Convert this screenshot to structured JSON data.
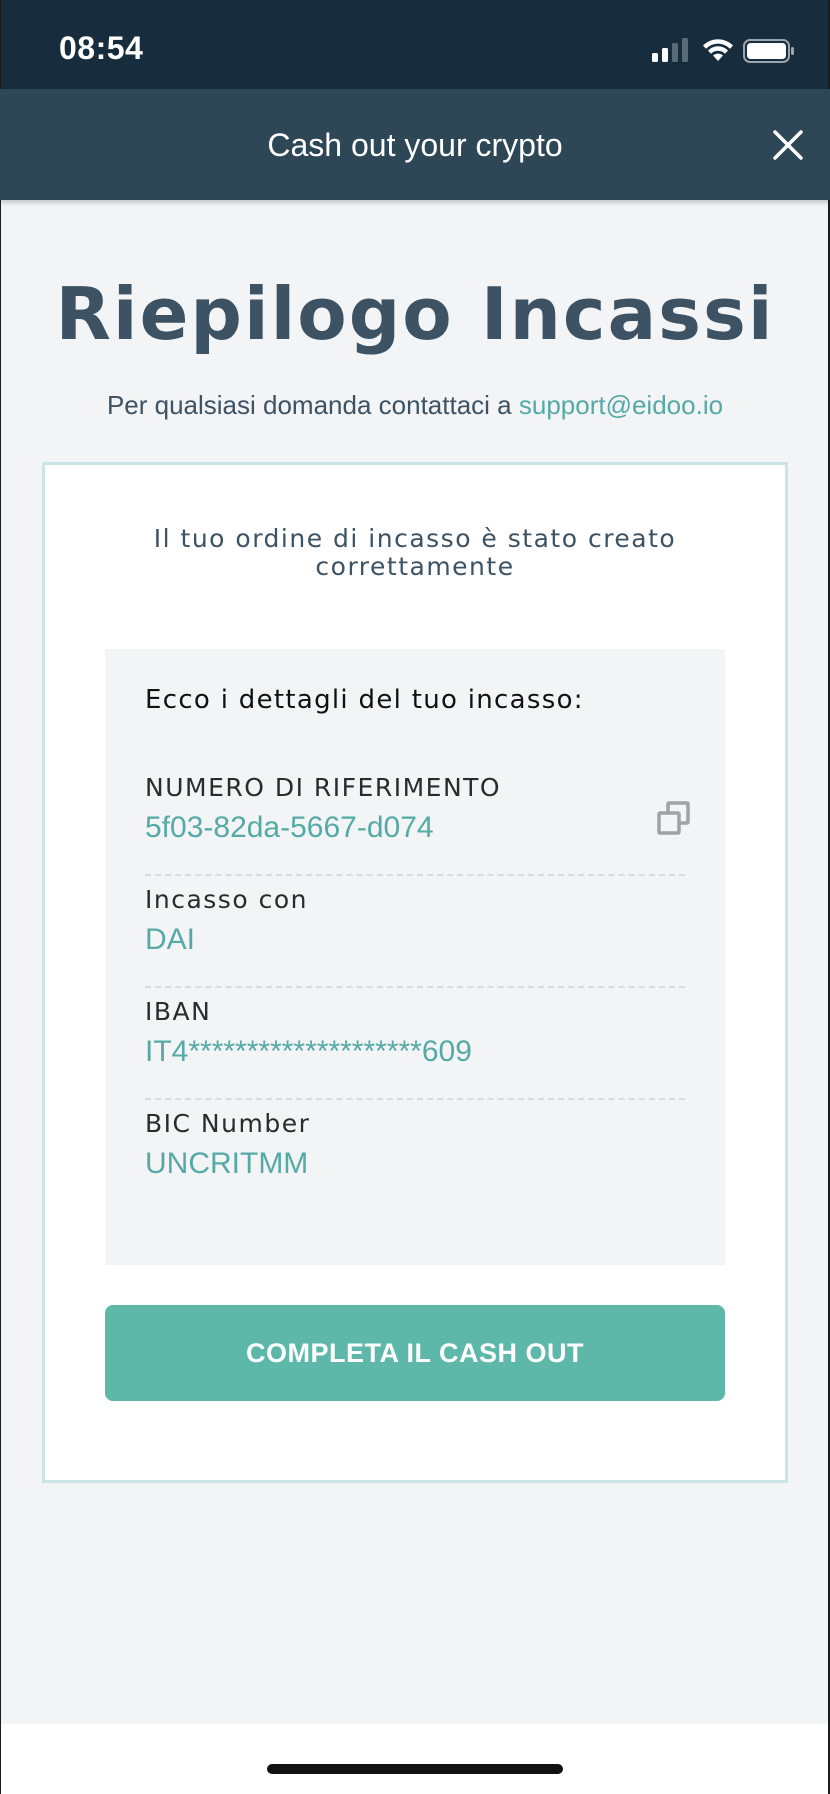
{
  "status_bar": {
    "time": "08:54"
  },
  "nav": {
    "title": "Cash out your crypto",
    "close_icon": "close-icon"
  },
  "page": {
    "title": "Riepilogo Incassi",
    "contact_text": "Per qualsiasi domanda contattaci a ",
    "contact_email": "support@eidoo.io"
  },
  "card": {
    "heading_line1": "Il tuo ordine di incasso è stato creato",
    "heading_line2": "correttamente",
    "details_heading": "Ecco i dettagli del tuo incasso:",
    "rows": [
      {
        "label": "NUMERO DI RIFERIMENTO",
        "value": "5f03-82da-5667-d074",
        "icon": "copy-icon"
      },
      {
        "label": "Incasso con",
        "value": "DAI"
      },
      {
        "label": "IBAN",
        "value": "IT4********************609"
      },
      {
        "label": "BIC Number",
        "value": "UNCRITMM"
      }
    ],
    "cta_label": "COMPLETA IL CASH OUT"
  },
  "colors": {
    "status_bar": "#172c3d",
    "nav_bar": "#2d4757",
    "accent": "#5db8aa",
    "link": "#55aaa5",
    "text_dark": "#3d5263",
    "background": "#f2f4f5"
  }
}
